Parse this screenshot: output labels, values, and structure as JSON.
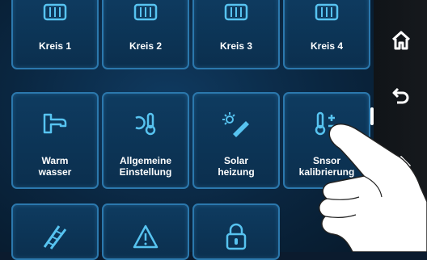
{
  "tiles_row1": [
    {
      "label": "Kreis 1",
      "icon": "heater-icon"
    },
    {
      "label": "Kreis 2",
      "icon": "heater-icon"
    },
    {
      "label": "Kreis 3",
      "icon": "heater-icon"
    },
    {
      "label": "Kreis 4",
      "icon": "heater-icon"
    }
  ],
  "tiles_row2": [
    {
      "line1": "Warm",
      "line2": "wasser",
      "icon": "faucet-icon"
    },
    {
      "line1": "Allgemeine",
      "line2": "Einstellung",
      "icon": "thermometer-settings-icon"
    },
    {
      "line1": "Solar",
      "line2": "heizung",
      "icon": "solar-panel-icon"
    },
    {
      "line1": "Snsor",
      "line2": "kalibrierung",
      "icon": "sensor-calibration-icon"
    }
  ],
  "tiles_row3": [
    {
      "icon": "ladder-icon"
    },
    {
      "icon": "warning-icon"
    },
    {
      "icon": "lock-icon"
    }
  ],
  "sidebar": {
    "buttons": [
      "home-icon",
      "back-icon",
      "chevron-up-icon"
    ]
  },
  "colors": {
    "tile_border": "#2b78ad",
    "icon": "#57c3f0",
    "background": "#0a2640"
  }
}
